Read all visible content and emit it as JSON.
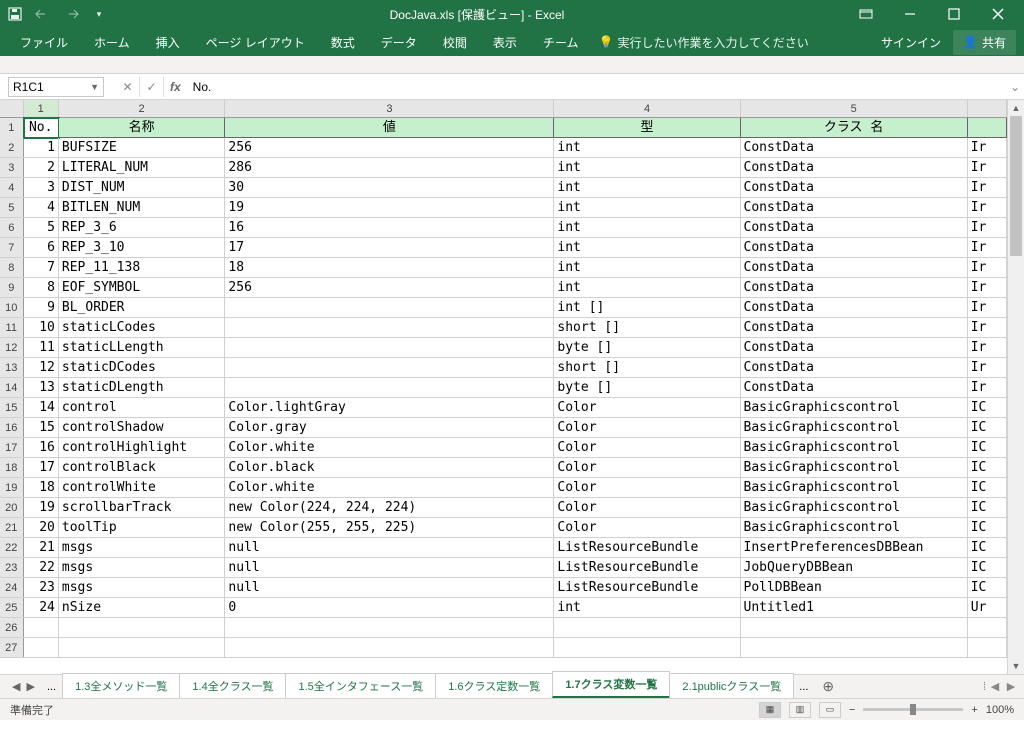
{
  "titlebar": {
    "title": "DocJava.xls  [保護ビュー] - Excel"
  },
  "ribbon": {
    "tabs": [
      "ファイル",
      "ホーム",
      "挿入",
      "ページ レイアウト",
      "数式",
      "データ",
      "校閲",
      "表示",
      "チーム"
    ],
    "tell_me": "実行したい作業を入力してください",
    "signin": "サインイン",
    "share": "共有"
  },
  "formula": {
    "namebox": "R1C1",
    "content": "No."
  },
  "columns": [
    "1",
    "2",
    "3",
    "4",
    "5"
  ],
  "header_row": [
    "No.",
    "名称",
    "値",
    "型",
    "クラス 名",
    ""
  ],
  "data_rows": [
    {
      "n": "1",
      "name": "BUFSIZE",
      "val": "256",
      "type": "int",
      "cls": "ConstData",
      "f": "Ir"
    },
    {
      "n": "2",
      "name": "LITERAL_NUM",
      "val": "286",
      "type": "int",
      "cls": "ConstData",
      "f": "Ir"
    },
    {
      "n": "3",
      "name": "DIST_NUM",
      "val": "30",
      "type": "int",
      "cls": "ConstData",
      "f": "Ir"
    },
    {
      "n": "4",
      "name": "BITLEN_NUM",
      "val": "19",
      "type": "int",
      "cls": "ConstData",
      "f": "Ir"
    },
    {
      "n": "5",
      "name": "REP_3_6",
      "val": "16",
      "type": "int",
      "cls": "ConstData",
      "f": "Ir"
    },
    {
      "n": "6",
      "name": "REP_3_10",
      "val": "17",
      "type": "int",
      "cls": "ConstData",
      "f": "Ir"
    },
    {
      "n": "7",
      "name": "REP_11_138",
      "val": "18",
      "type": "int",
      "cls": "ConstData",
      "f": "Ir"
    },
    {
      "n": "8",
      "name": "EOF_SYMBOL",
      "val": "256",
      "type": "int",
      "cls": "ConstData",
      "f": "Ir"
    },
    {
      "n": "9",
      "name": "BL_ORDER",
      "val": "",
      "type": "int []",
      "cls": "ConstData",
      "f": "Ir"
    },
    {
      "n": "10",
      "name": "staticLCodes",
      "val": "",
      "type": "short []",
      "cls": "ConstData",
      "f": "Ir"
    },
    {
      "n": "11",
      "name": "staticLLength",
      "val": "",
      "type": "byte []",
      "cls": "ConstData",
      "f": "Ir"
    },
    {
      "n": "12",
      "name": "staticDCodes",
      "val": "",
      "type": "short []",
      "cls": "ConstData",
      "f": "Ir"
    },
    {
      "n": "13",
      "name": "staticDLength",
      "val": "",
      "type": "byte []",
      "cls": "ConstData",
      "f": "Ir"
    },
    {
      "n": "14",
      "name": "control",
      "val": "Color.lightGray",
      "type": "Color",
      "cls": "BasicGraphicscontrol",
      "f": "IC"
    },
    {
      "n": "15",
      "name": "controlShadow",
      "val": "Color.gray",
      "type": "Color",
      "cls": "BasicGraphicscontrol",
      "f": "IC"
    },
    {
      "n": "16",
      "name": "controlHighlight",
      "val": "Color.white",
      "type": "Color",
      "cls": "BasicGraphicscontrol",
      "f": "IC"
    },
    {
      "n": "17",
      "name": "controlBlack",
      "val": "Color.black",
      "type": "Color",
      "cls": "BasicGraphicscontrol",
      "f": "IC"
    },
    {
      "n": "18",
      "name": "controlWhite",
      "val": "Color.white",
      "type": "Color",
      "cls": "BasicGraphicscontrol",
      "f": "IC"
    },
    {
      "n": "19",
      "name": "scrollbarTrack",
      "val": "new Color(224, 224, 224)",
      "type": "Color",
      "cls": "BasicGraphicscontrol",
      "f": "IC"
    },
    {
      "n": "20",
      "name": "toolTip",
      "val": "new Color(255, 255, 225)",
      "type": "Color",
      "cls": "BasicGraphicscontrol",
      "f": "IC"
    },
    {
      "n": "21",
      "name": "msgs",
      "val": "null",
      "type": "ListResourceBundle",
      "cls": "InsertPreferencesDBBean",
      "f": "IC"
    },
    {
      "n": "22",
      "name": "msgs",
      "val": "null",
      "type": "ListResourceBundle",
      "cls": "JobQueryDBBean",
      "f": "IC"
    },
    {
      "n": "23",
      "name": "msgs",
      "val": "null",
      "type": "ListResourceBundle",
      "cls": "PollDBBean",
      "f": "IC"
    },
    {
      "n": "24",
      "name": "nSize",
      "val": "0",
      "type": "int",
      "cls": "Untitled1",
      "f": "Ur"
    }
  ],
  "blank_rows": [
    26,
    27
  ],
  "sheets": {
    "ellipsis": "...",
    "tabs": [
      "1.3全メソッド一覧",
      "1.4全クラス一覧",
      "1.5全インタフェース一覧",
      "1.6クラス定数一覧",
      "1.7クラス変数一覧",
      "2.1publicクラス一覧"
    ],
    "active_index": 4
  },
  "status": {
    "ready": "準備完了",
    "zoom": "100%"
  }
}
